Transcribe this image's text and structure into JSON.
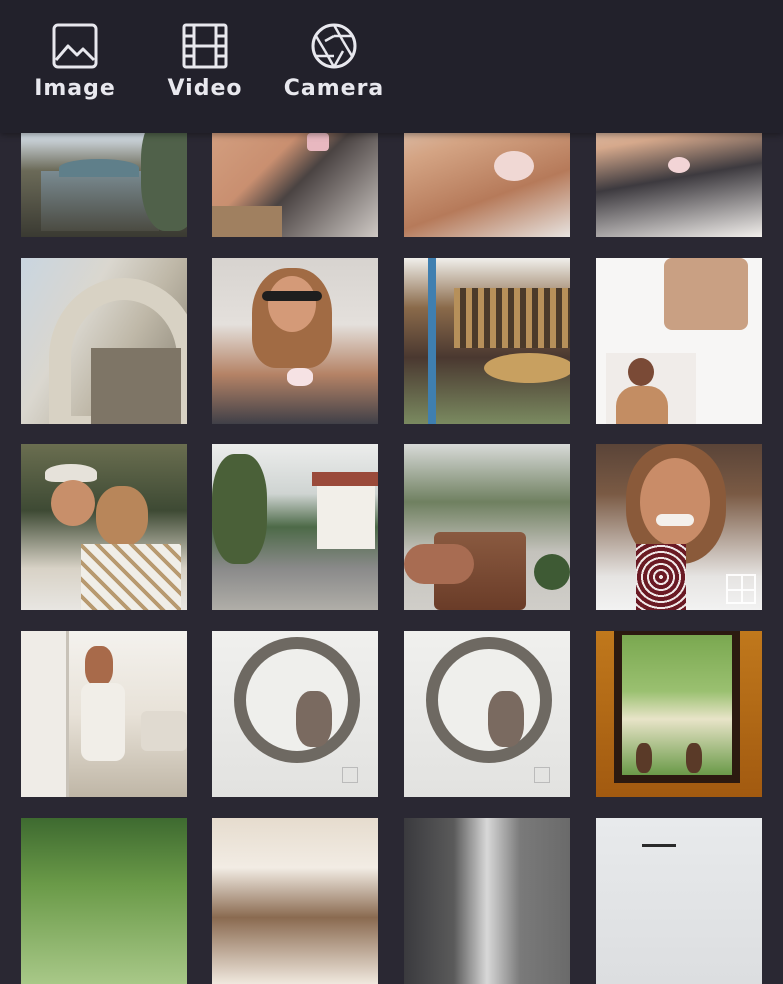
{
  "toolbar": {
    "image_label": "Image",
    "video_label": "Video",
    "camera_label": "Camera"
  },
  "gallery": {
    "photos": [
      {
        "subject": "carousel under trees"
      },
      {
        "subject": "legs with yogurt cup"
      },
      {
        "subject": "woman holding yogurt cup"
      },
      {
        "subject": "woman sitting on bench"
      },
      {
        "subject": "stone archway building"
      },
      {
        "subject": "smiling woman with sunglasses"
      },
      {
        "subject": "carousel close-up"
      },
      {
        "subject": "tan knit outfit"
      },
      {
        "subject": "two women selfie"
      },
      {
        "subject": "street with white house"
      },
      {
        "subject": "hand holding coffee glass"
      },
      {
        "subject": "smiling woman with scarf"
      },
      {
        "subject": "mirror selfie in living room"
      },
      {
        "subject": "round mirror reflection"
      },
      {
        "subject": "round mirror reflection"
      },
      {
        "subject": "window with plants"
      },
      {
        "subject": "garden trees"
      },
      {
        "subject": "ornate ceiling"
      },
      {
        "subject": "building and tower"
      },
      {
        "subject": "street lamps"
      }
    ]
  },
  "colors": {
    "toolbar_bg": "#22212b",
    "page_bg": "#2a2833",
    "icon_color": "#e8e8ee"
  }
}
